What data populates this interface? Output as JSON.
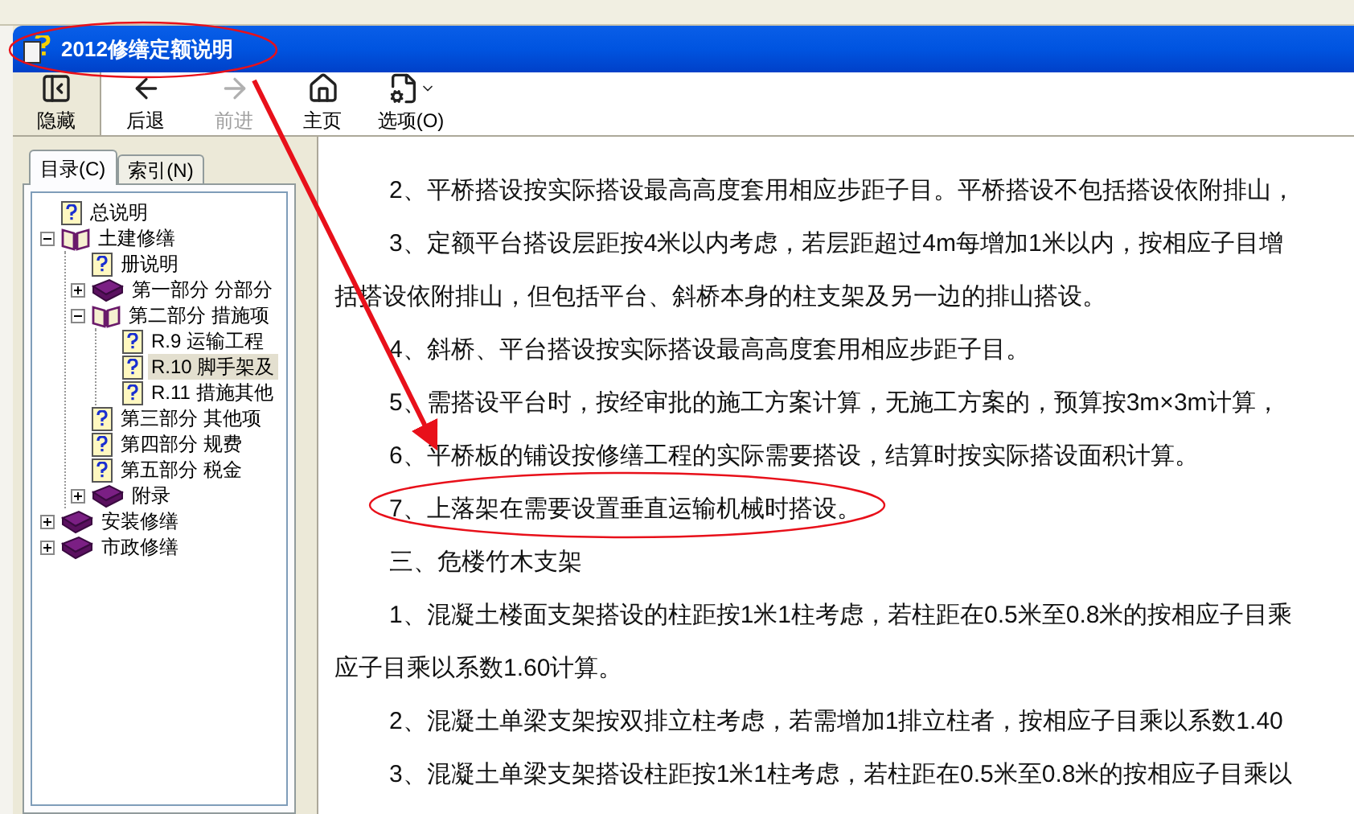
{
  "window": {
    "title": "2012修缮定额说明"
  },
  "toolbar": [
    {
      "label": "隐藏",
      "kind": "hide",
      "disabled": false
    },
    {
      "label": "后退",
      "kind": "back",
      "disabled": false
    },
    {
      "label": "前进",
      "kind": "forward",
      "disabled": true
    },
    {
      "label": "主页",
      "kind": "home",
      "disabled": false
    },
    {
      "label": "选项(O)",
      "kind": "options",
      "disabled": false
    }
  ],
  "tabs": [
    {
      "label": "目录(C)",
      "selected": true
    },
    {
      "label": "索引(N)",
      "selected": false
    }
  ],
  "tree": [
    {
      "label": "总说明",
      "kind": "page",
      "selected": false
    },
    {
      "label": "土建修缮",
      "kind": "book",
      "expanded": true,
      "selected": false,
      "children": [
        {
          "label": "册说明",
          "kind": "page",
          "selected": false
        },
        {
          "label": "第一部分 分部分",
          "kind": "book",
          "expanded": false,
          "selected": false
        },
        {
          "label": "第二部分 措施项",
          "kind": "book",
          "expanded": true,
          "selected": false,
          "children": [
            {
              "label": "R.9 运输工程",
              "kind": "page",
              "selected": false
            },
            {
              "label": "R.10 脚手架及",
              "kind": "page",
              "selected": true
            },
            {
              "label": "R.11 措施其他",
              "kind": "page",
              "selected": false
            }
          ]
        },
        {
          "label": "第三部分 其他项",
          "kind": "page",
          "selected": false
        },
        {
          "label": "第四部分 规费",
          "kind": "page",
          "selected": false
        },
        {
          "label": "第五部分 税金",
          "kind": "page",
          "selected": false
        },
        {
          "label": "附录",
          "kind": "book",
          "expanded": false,
          "selected": false
        }
      ]
    },
    {
      "label": "安装修缮",
      "kind": "book",
      "expanded": false,
      "selected": false
    },
    {
      "label": "市政修缮",
      "kind": "book",
      "expanded": false,
      "selected": false
    }
  ],
  "content": {
    "paragraphs": [
      {
        "kind": "numbered",
        "text": "2、平桥搭设按实际搭设最高高度套用相应步距子目。平桥搭设不包括搭设依附排山，"
      },
      {
        "kind": "numbered",
        "text": "3、定额平台搭设层距按4米以内考虑，若层距超过4m每增加1米以内，按相应子目增"
      },
      {
        "kind": "continuation",
        "text": "括搭设依附排山，但包括平台、斜桥本身的柱支架及另一边的排山搭设。"
      },
      {
        "kind": "numbered",
        "text": "4、斜桥、平台搭设按实际搭设最高高度套用相应步距子目。"
      },
      {
        "kind": "numbered",
        "text": "5、需搭设平台时，按经审批的施工方案计算，无施工方案的，预算按3m×3m计算，"
      },
      {
        "kind": "numbered",
        "text": "6、平桥板的铺设按修缮工程的实际需要搭设，结算时按实际搭设面积计算。"
      },
      {
        "kind": "numbered",
        "text": "7、上落架在需要设置垂直运输机械时搭设。"
      },
      {
        "kind": "heading",
        "text": "三、危楼竹木支架"
      },
      {
        "kind": "numbered",
        "text": "1、混凝土楼面支架搭设的柱距按1米1柱考虑，若柱距在0.5米至0.8米的按相应子目乘"
      },
      {
        "kind": "continuation",
        "text": "应子目乘以系数1.60计算。"
      },
      {
        "kind": "numbered",
        "text": "2、混凝土单梁支架按双排立柱考虑，若需增加1排立柱者，按相应子目乘以系数1.40"
      },
      {
        "kind": "numbered",
        "text": "3、混凝土单梁支架搭设柱距按1米1柱考虑，若柱距在0.5米至0.8米的按相应子目乘以"
      }
    ]
  }
}
